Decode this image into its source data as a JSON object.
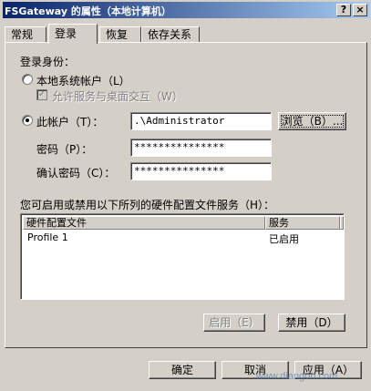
{
  "window": {
    "title": "FSGateway 的属性（本地计算机）",
    "help_btn": "?",
    "close_btn": "×"
  },
  "tabs": [
    {
      "label": "常规"
    },
    {
      "label": "登录"
    },
    {
      "label": "恢复"
    },
    {
      "label": "依存关系"
    }
  ],
  "logon": {
    "section_label": "登录身份：",
    "local_system_label": "本地系统帐户（L）",
    "allow_desktop_label": "允许服务与桌面交互（W）",
    "this_account_label": "此帐户（T）：",
    "account_value": ".\\Administrator",
    "browse_button": "浏览（B）...",
    "password_label": "密码（P）：",
    "password_value": "***************",
    "confirm_label": "确认密码（C）：",
    "confirm_value": "***************"
  },
  "hardware": {
    "caption": "您可启用或禁用以下所列的硬件配置文件服务（H）：",
    "columns": [
      "硬件配置文件",
      "服务"
    ],
    "rows": [
      {
        "profile": "Profile 1",
        "service": "已启用"
      }
    ],
    "enable_button": "启用（E）",
    "disable_button": "禁用（D）"
  },
  "footer": {
    "ok_button": "确定",
    "cancel_button": "取消",
    "apply_button": "应用（A）"
  },
  "watermark": "www.diangon.com"
}
